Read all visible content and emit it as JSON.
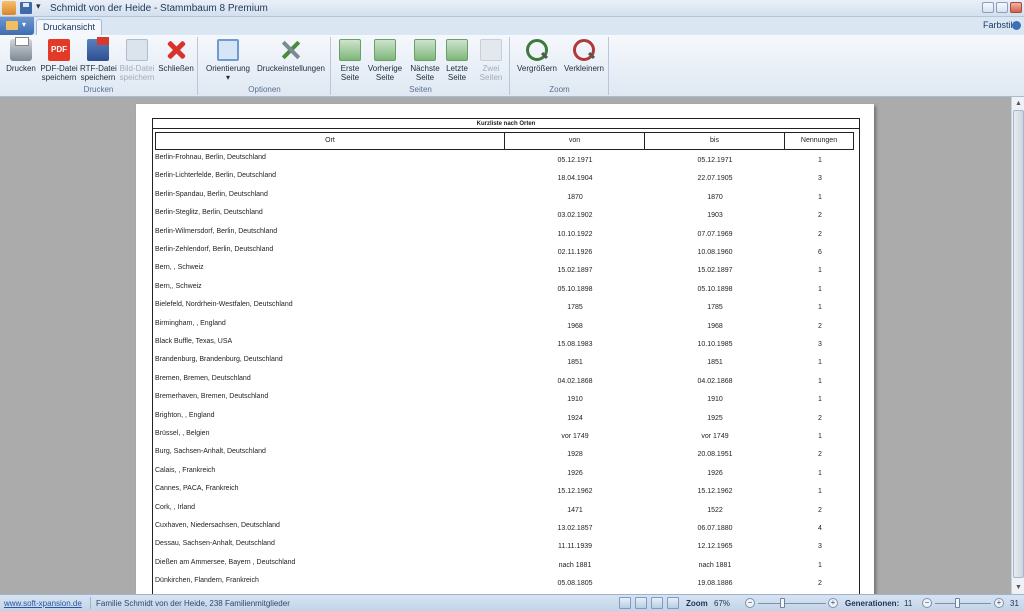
{
  "window": {
    "title": "Schmidt von der Heide - Stammbaum 8 Premium"
  },
  "tabs": {
    "active": "Druckansicht",
    "farbstil": "Farbstil"
  },
  "ribbon": {
    "groups": {
      "drucken": "Drucken",
      "optionen": "Optionen",
      "seiten": "Seiten",
      "zoom": "Zoom"
    },
    "buttons": {
      "print": [
        "Drucken",
        ""
      ],
      "pdf": [
        "PDF-Datei",
        "speichern"
      ],
      "pdf_icon_text": "PDF",
      "rtf": [
        "RTF-Datei",
        "speichern"
      ],
      "image": [
        "Bild-Datei",
        "speichern"
      ],
      "close": [
        "Schließen",
        ""
      ],
      "orientation": [
        "Orientierung",
        "▾"
      ],
      "print_settings": [
        "Druckeinstellungen",
        ""
      ],
      "first": [
        "Erste",
        "Seite"
      ],
      "previous": [
        "Vorherige",
        "Seite"
      ],
      "next": [
        "Nächste",
        "Seite"
      ],
      "last": [
        "Letzte",
        "Seite"
      ],
      "two": [
        "Zwei",
        "Seiten"
      ],
      "zoom_in": [
        "Vergrößern",
        ""
      ],
      "zoom_out": [
        "Verkleinern",
        ""
      ]
    }
  },
  "report": {
    "title": "Kurzliste nach Orten",
    "columns": [
      "Ort",
      "von",
      "bis",
      "Nennungen"
    ],
    "rows": [
      [
        "Berlin-Frohnau, Berlin, Deutschland",
        "05.12.1971",
        "05.12.1971",
        "1"
      ],
      [
        "Berlin-Lichterfelde, Berlin, Deutschland",
        "18.04.1904",
        "22.07.1905",
        "3"
      ],
      [
        "Berlin-Spandau, Berlin, Deutschland",
        "1870",
        "1870",
        "1"
      ],
      [
        "Berlin-Steglitz, Berlin, Deutschland",
        "03.02.1902",
        "1903",
        "2"
      ],
      [
        "Berlin-Wilmersdorf, Berlin, Deutschland",
        "10.10.1922",
        "07.07.1969",
        "2"
      ],
      [
        "Berlin-Zehlendorf, Berlin, Deutschland",
        "02.11.1926",
        "10.08.1960",
        "6"
      ],
      [
        "Bern, , Schweiz",
        "15.02.1897",
        "15.02.1897",
        "1"
      ],
      [
        "Bern,, Schweiz",
        "05.10.1898",
        "05.10.1898",
        "1"
      ],
      [
        "Bielefeld, Nordrhein-Westfalen, Deutschland",
        "1785",
        "1785",
        "1"
      ],
      [
        "Birmingham, , England",
        "1968",
        "1968",
        "2"
      ],
      [
        "Black Buffle, Texas, USA",
        "15.08.1983",
        "10.10.1985",
        "3"
      ],
      [
        "Brandenburg, Brandenburg, Deutschland",
        "1851",
        "1851",
        "1"
      ],
      [
        "Bremen, Bremen, Deutschland",
        "04.02.1868",
        "04.02.1868",
        "1"
      ],
      [
        "Bremerhaven, Bremen, Deutschland",
        "1910",
        "1910",
        "1"
      ],
      [
        "Brighton, , England",
        "1924",
        "1925",
        "2"
      ],
      [
        "Brüssel, , Belgien",
        "vor 1749",
        "vor 1749",
        "1"
      ],
      [
        "Burg, Sachsen-Anhalt, Deutschland",
        "1928",
        "20.08.1951",
        "2"
      ],
      [
        "Calais, , Frankreich",
        "1926",
        "1926",
        "1"
      ],
      [
        "Cannes, PACA, Frankreich",
        "15.12.1962",
        "15.12.1962",
        "1"
      ],
      [
        "Cork, , Irland",
        "1471",
        "1522",
        "2"
      ],
      [
        "Cuxhaven, Niedersachsen, Deutschland",
        "13.02.1857",
        "06.07.1880",
        "4"
      ],
      [
        "Dessau, Sachsen-Anhalt, Deutschland",
        "11.11.1939",
        "12.12.1965",
        "3"
      ],
      [
        "Dießen am Ammersee, Bayern  , Deutschland",
        "nach 1881",
        "nach 1881",
        "1"
      ],
      [
        "Dünkirchen, Flandern, Frankreich",
        "05.08.1805",
        "19.08.1886",
        "2"
      ]
    ]
  },
  "statusbar": {
    "link": "www.soft-xpansion.de",
    "family": "Familie Schmidt von der Heide, 238 Familienmitglieder",
    "zoom_label": "Zoom",
    "zoom_value": "67%",
    "zoom_fraction": 0.67,
    "generations_label": "Generationen:",
    "generations_value": "11",
    "generations_max": "31"
  }
}
